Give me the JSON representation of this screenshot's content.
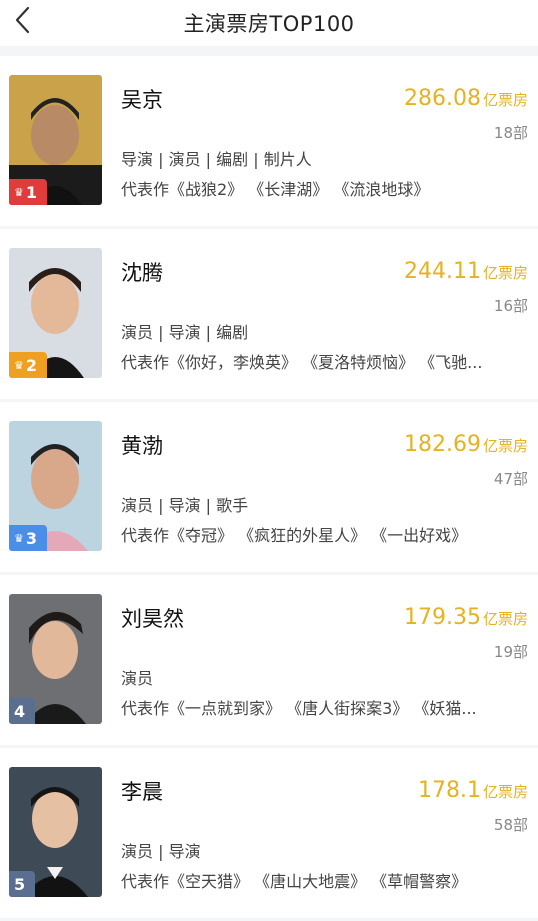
{
  "header": {
    "title": "主演票房TOP100",
    "back_icon": "back-icon"
  },
  "accent": "#e6b21f",
  "actors": [
    {
      "name": "吴京",
      "rank": "1",
      "badge_color": "#e03c3c",
      "box_value": "286.08",
      "box_unit": "亿票房",
      "count": "18部",
      "roles": "导演 | 演员 | 编剧 | 制片人",
      "works": "代表作《战狼2》 《长津湖》 《流浪地球》"
    },
    {
      "name": "沈腾",
      "rank": "2",
      "badge_color": "#f0a020",
      "box_value": "244.11",
      "box_unit": "亿票房",
      "count": "16部",
      "roles": "演员 | 导演 | 编剧",
      "works": "代表作《你好，李焕英》 《夏洛特烦恼》 《飞驰..."
    },
    {
      "name": "黄渤",
      "rank": "3",
      "badge_color": "#4a8ee8",
      "box_value": "182.69",
      "box_unit": "亿票房",
      "count": "47部",
      "roles": "演员 | 导演 | 歌手",
      "works": "代表作《夺冠》 《疯狂的外星人》 《一出好戏》"
    },
    {
      "name": "刘昊然",
      "rank": "4",
      "badge_color": "#5a6f8f",
      "box_value": "179.35",
      "box_unit": "亿票房",
      "count": "19部",
      "roles": "演员",
      "works": "代表作《一点就到家》 《唐人街探案3》 《妖猫..."
    },
    {
      "name": "李晨",
      "rank": "5",
      "badge_color": "#5a6f8f",
      "box_value": "178.1",
      "box_unit": "亿票房",
      "count": "58部",
      "roles": "演员 | 导演",
      "works": "代表作《空天猎》 《唐山大地震》 《草帽警察》"
    }
  ]
}
